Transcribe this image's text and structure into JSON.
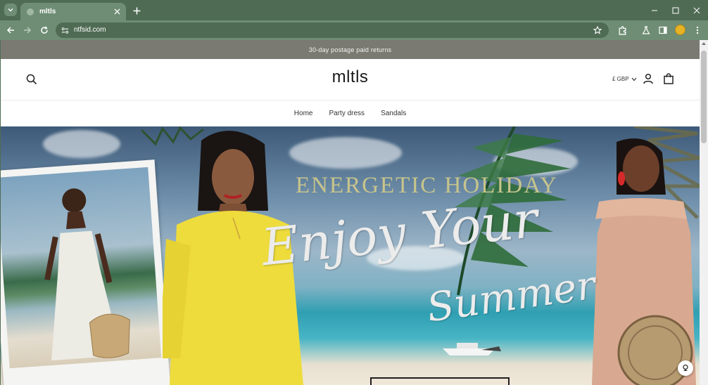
{
  "browser": {
    "tab_title": "mltls",
    "url": "ntfsid.com"
  },
  "store": {
    "announcement": "30-day postage paid returns",
    "logo": "mltls",
    "currency": "£ GBP",
    "nav": [
      "Home",
      "Party dress",
      "Sandals"
    ]
  },
  "hero": {
    "headline": "ENERGETIC HOLIDAY",
    "script_line1": "Enjoy Your",
    "script_line2": "Summer"
  },
  "colors": {
    "chrome": "#4f6b54",
    "toolbar": "#6e8d74",
    "announce_bar": "#7a7a73",
    "headline": "#c7c48c"
  },
  "icons": [
    "tab-search-icon",
    "close-icon",
    "plus-icon",
    "minimize-icon",
    "maximize-icon",
    "back-arrow-icon",
    "forward-arrow-icon",
    "reload-icon",
    "site-info-icon",
    "star-icon",
    "extensions-icon",
    "labs-icon",
    "side-panel-icon",
    "menu-icon",
    "search-icon",
    "account-icon",
    "shopping-bag-icon",
    "chevron-down-icon",
    "chat-icon"
  ]
}
